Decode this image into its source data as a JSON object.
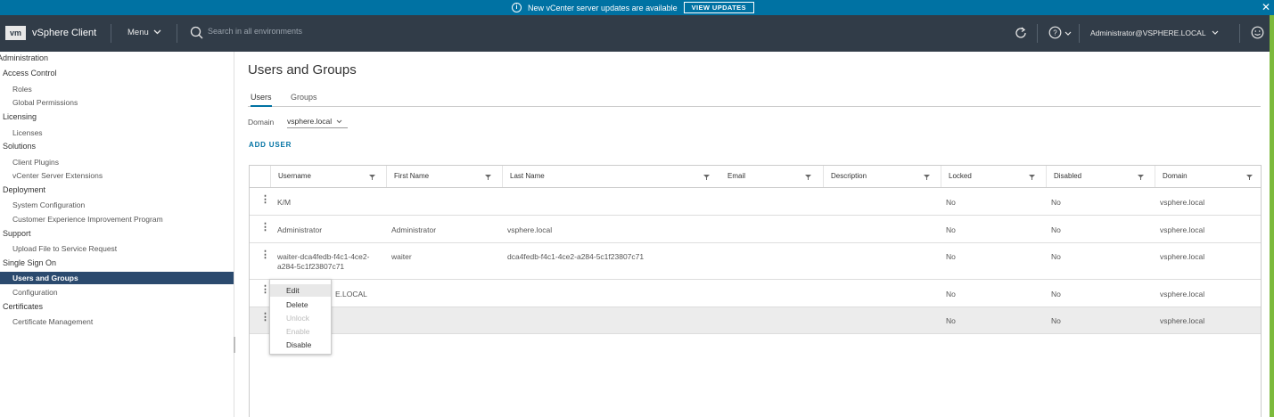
{
  "banner": {
    "message": "New vCenter server updates are available",
    "button_label": "VIEW UPDATES",
    "close": "✕"
  },
  "header": {
    "logo": "vm",
    "app_title": "vSphere Client",
    "menu_label": "Menu",
    "search_placeholder": "Search in all environments",
    "user_label": "Administrator@VSPHERE.LOCAL"
  },
  "sidebar": {
    "items": [
      {
        "label": "Administration",
        "kind": "head"
      },
      {
        "label": "Access Control",
        "kind": "head"
      },
      {
        "label": "Roles",
        "kind": "sub"
      },
      {
        "label": "Global Permissions",
        "kind": "sub"
      },
      {
        "label": "Licensing",
        "kind": "head"
      },
      {
        "label": "Licenses",
        "kind": "sub"
      },
      {
        "label": "Solutions",
        "kind": "head"
      },
      {
        "label": "Client Plugins",
        "kind": "sub"
      },
      {
        "label": "vCenter Server Extensions",
        "kind": "sub"
      },
      {
        "label": "Deployment",
        "kind": "head"
      },
      {
        "label": "System Configuration",
        "kind": "sub"
      },
      {
        "label": "Customer Experience Improvement Program",
        "kind": "sub"
      },
      {
        "label": "Support",
        "kind": "head"
      },
      {
        "label": "Upload File to Service Request",
        "kind": "sub"
      },
      {
        "label": "Single Sign On",
        "kind": "head"
      },
      {
        "label": "Users and Groups",
        "kind": "sub",
        "active": true
      },
      {
        "label": "Configuration",
        "kind": "sub"
      },
      {
        "label": "Certificates",
        "kind": "head"
      },
      {
        "label": "Certificate Management",
        "kind": "sub"
      }
    ]
  },
  "main": {
    "title": "Users and Groups",
    "tabs": [
      {
        "label": "Users",
        "active": true
      },
      {
        "label": "Groups",
        "active": false
      }
    ],
    "domain_label": "Domain",
    "domain_value": "vsphere.local",
    "add_user_label": "ADD USER"
  },
  "table": {
    "columns": [
      "Username",
      "First Name",
      "Last Name",
      "Email",
      "Description",
      "Locked",
      "Disabled",
      "Domain"
    ],
    "rows": [
      {
        "username": "K/M",
        "first_name": "",
        "last_name": "",
        "email": "",
        "description": "",
        "locked": "No",
        "disabled": "No",
        "domain": "vsphere.local"
      },
      {
        "username": "Administrator",
        "first_name": "Administrator",
        "last_name": "vsphere.local",
        "email": "",
        "description": "",
        "locked": "No",
        "disabled": "No",
        "domain": "vsphere.local"
      },
      {
        "username": "waiter-dca4fedb-f4c1-4ce2-",
        "username_line2": "a284-5c1f23807c71",
        "first_name": "waiter",
        "last_name": "dca4fedb-f4c1-4ce2-a284-5c1f23807c71",
        "email": "",
        "description": "",
        "locked": "No",
        "disabled": "No",
        "domain": "vsphere.local"
      },
      {
        "username": "E.LOCAL",
        "first_name": "",
        "last_name": "",
        "email": "",
        "description": "",
        "locked": "No",
        "disabled": "No",
        "domain": "vsphere.local"
      },
      {
        "username": "",
        "first_name": "",
        "last_name": "",
        "email": "",
        "description": "",
        "locked": "No",
        "disabled": "No",
        "domain": "vsphere.local"
      }
    ]
  },
  "context_menu": {
    "items": [
      {
        "label": "Edit",
        "state": "highlighted"
      },
      {
        "label": "Delete",
        "state": "enabled"
      },
      {
        "label": "Unlock",
        "state": "disabled"
      },
      {
        "label": "Enable",
        "state": "disabled"
      },
      {
        "label": "Disable",
        "state": "enabled"
      }
    ]
  },
  "colors": {
    "banner": "#0072a3",
    "header": "#313c48",
    "active_nav": "#2b4a6e",
    "link": "#0072a3",
    "accent_edge": "#7cba3c"
  }
}
